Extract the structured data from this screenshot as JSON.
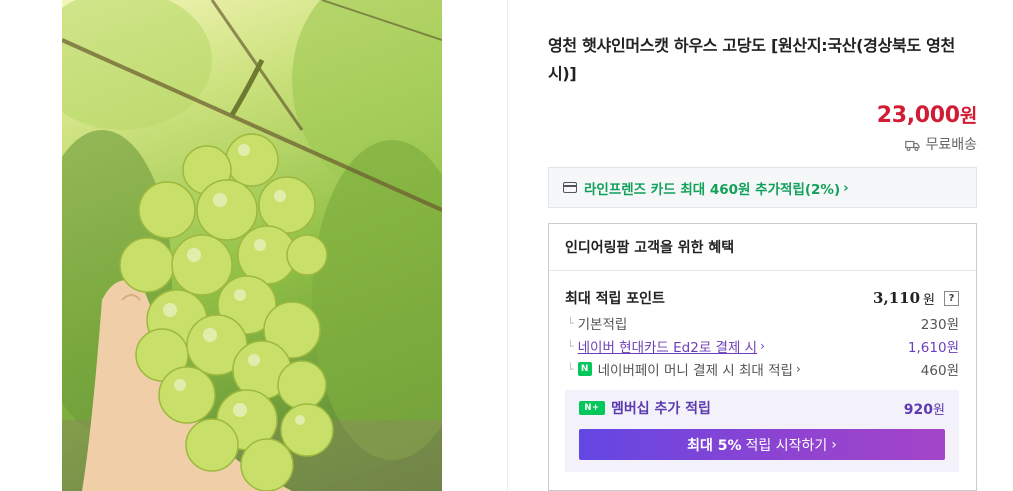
{
  "product": {
    "title": "영천 햇샤인머스캣 하우스 고당도 [원산지:국산(경상북도 영천시)]",
    "image_alt": "shine-muscat-grapes-photo",
    "price_value": "23,000",
    "price_unit": "원",
    "shipping_label": "무료배송",
    "shipping_icon": "truck-icon"
  },
  "card_banner": {
    "icon": "credit-card-icon",
    "text": "라인프렌즈 카드 최대 460원 추가적립(2%)",
    "chevron": "›"
  },
  "benefits": {
    "heading": "인디어링팜 고객을 위한 혜택",
    "max_points_label": "최대 적립 포인트",
    "max_points_value": "3,110",
    "won": "원",
    "help_label": "?",
    "rows": [
      {
        "tree": "└",
        "label": "기본적립",
        "value": "230",
        "unit": "원"
      },
      {
        "tree": "└",
        "label": "네이버 현대카드 Ed2로 결제 시",
        "chevron": "›",
        "value": "1,610",
        "unit": "원"
      },
      {
        "tree": "└",
        "badge": "N",
        "label": "네이버페이 머니 결제 시 최대 적립",
        "chevron": "›",
        "value": "460",
        "unit": "원"
      }
    ],
    "membership": {
      "badge": "N+",
      "label": "멤버십 추가 적립",
      "value": "920",
      "unit": "원",
      "button_bold": "최대 5%",
      "button_text": "적립 시작하기",
      "button_chevron": "›"
    }
  },
  "colors": {
    "price": "#d01d34",
    "card_green": "#12a15a",
    "purple": "#6d3fb8",
    "naver_green": "#03c75a",
    "button_gradient_start": "#6347e3",
    "button_gradient_end": "#a445c8"
  }
}
